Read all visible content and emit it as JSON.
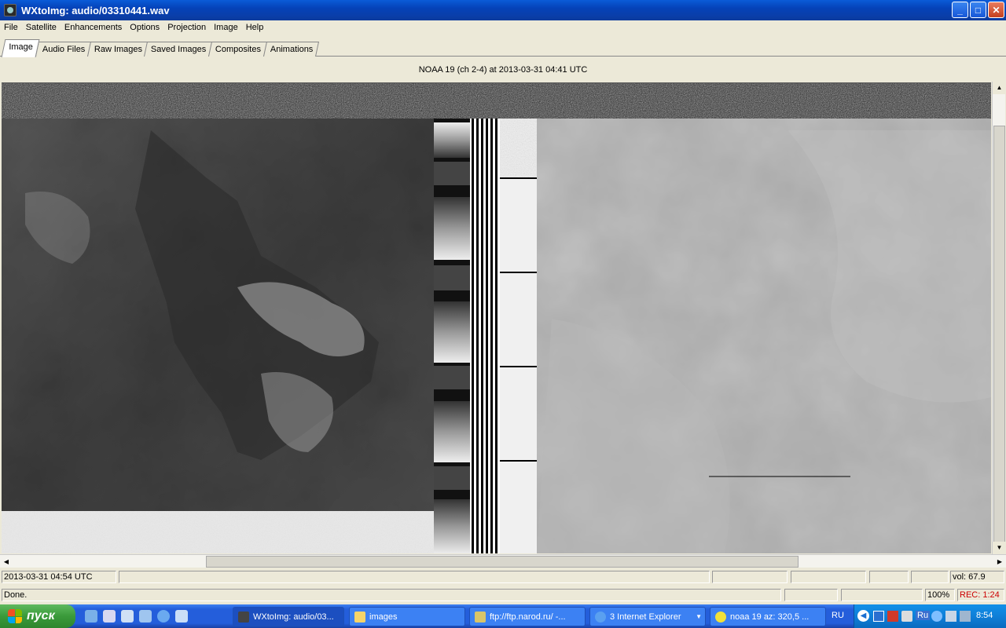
{
  "window": {
    "title": "WXtoImg: audio/03310441.wav",
    "min": "_",
    "max": "□",
    "close": "✕"
  },
  "menu": [
    "File",
    "Satellite",
    "Enhancements",
    "Options",
    "Projection",
    "Image",
    "Help"
  ],
  "tabs": [
    {
      "label": "Image",
      "active": true
    },
    {
      "label": "Audio Files",
      "active": false
    },
    {
      "label": "Raw Images",
      "active": false
    },
    {
      "label": "Saved Images",
      "active": false
    },
    {
      "label": "Composites",
      "active": false
    },
    {
      "label": "Animations",
      "active": false
    }
  ],
  "image_caption": "NOAA 19 (ch 2-4) at 2013-03-31  04:41 UTC",
  "status": {
    "time": "2013-03-31  04:54 UTC",
    "volume": "vol: 67.9",
    "message": "Done.",
    "zoom": "100%",
    "recording": "REC: 1:24"
  },
  "taskbar": {
    "start_label": "пуск",
    "tasks": [
      {
        "label": "WXtoImg: audio/03...",
        "icon": "wxtoimg-icon",
        "active": true
      },
      {
        "label": "images",
        "icon": "folder-icon",
        "active": false
      },
      {
        "label": "ftp://ftp.narod.ru/ -...",
        "icon": "ftp-icon",
        "active": false
      },
      {
        "label": "3 Internet Explorer",
        "icon": "ie-icon",
        "active": false
      },
      {
        "label": "noaa 19  az: 320,5 ...",
        "icon": "satellite-icon",
        "active": false
      }
    ],
    "language": "RU",
    "tray_lang": "Ru",
    "clock": "8:54"
  },
  "colors": {
    "titlebar": "#0a5bd8",
    "face": "#ece9d8",
    "taskbar": "#245edb",
    "start": "#3a9a3a",
    "recording_text": "#cc0000"
  }
}
